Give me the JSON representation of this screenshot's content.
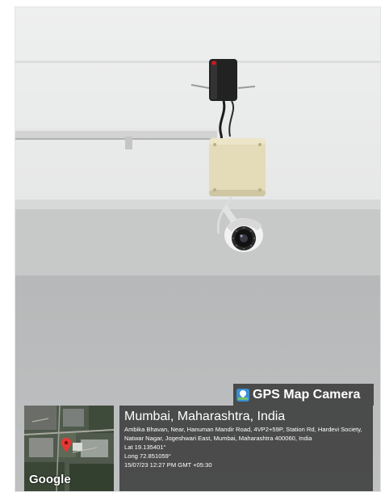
{
  "overlay": {
    "brand_label": "GPS Map Camera",
    "map_attribution": "Google",
    "location_title": "Mumbai, Maharashtra, India",
    "address": "Ambika Bhavan, Near, Hanuman Mandir Road, 4VP2+59P, Station Rd, Hardevi Society, Natwar Nagar, Jogeshwari East, Mumbai, Maharashtra 400060, India",
    "latitude": "Lat 19.135401°",
    "longitude": "Long 72.851059°",
    "timestamp": "15/07/23 12:27 PM GMT +05:30"
  },
  "icons": [
    "gps-map-camera-app-icon",
    "map-location-pin-icon"
  ],
  "colors": {
    "overlay_bg": "#1e1e1e",
    "ceiling": "#eceeee",
    "wall_band": "#c6c7c7",
    "lower_wall": "#b9bbbc",
    "power_led": "#e01515",
    "pin": "#e53935"
  }
}
